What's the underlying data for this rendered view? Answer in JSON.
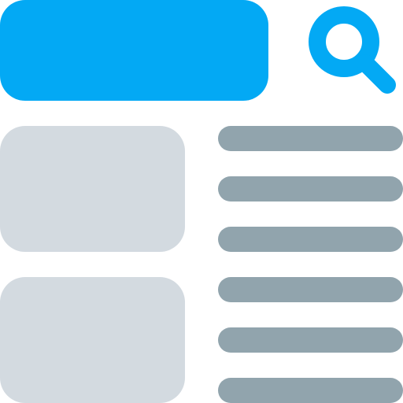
{
  "colors": {
    "accent": "#03a9f4",
    "card": "#d3dae0",
    "line": "#91a4ad",
    "background": "#ffffff"
  },
  "search": {
    "icon": "search-icon"
  },
  "cards": [
    {
      "icon": "image-placeholder"
    },
    {
      "icon": "image-placeholder"
    }
  ],
  "text_lines_count": 6
}
